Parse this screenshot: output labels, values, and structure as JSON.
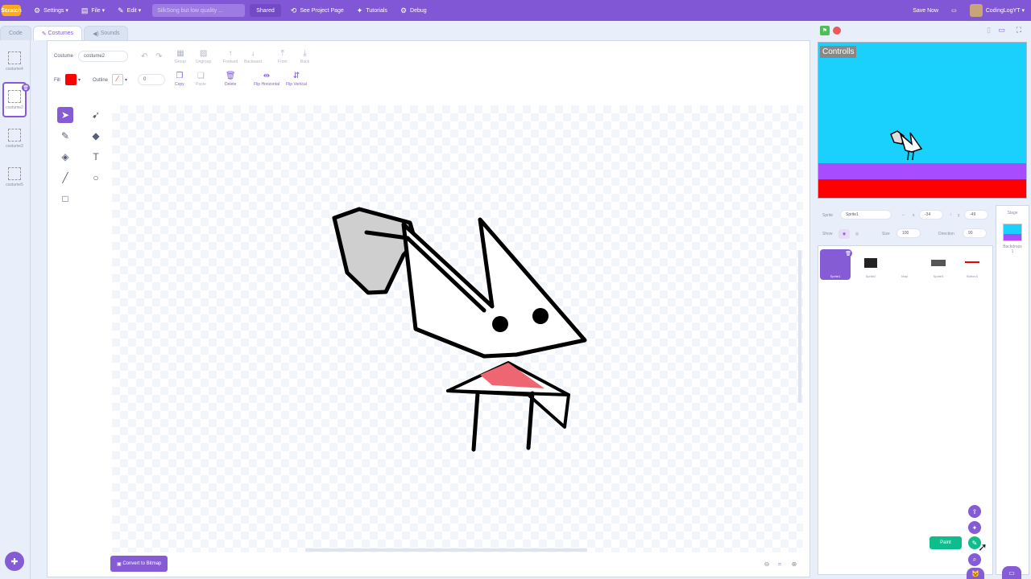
{
  "menubar": {
    "logo": "Scratch",
    "settings": "Settings",
    "file": "File",
    "edit": "Edit",
    "project_title": "SilkSong but low quality ...",
    "shared": "Shared",
    "see_project": "See Project Page",
    "tutorials": "Tutorials",
    "debug": "Debug",
    "save_now": "Save Now",
    "username": "CodingLogYT"
  },
  "tabs": {
    "code": "Code",
    "costumes": "Costumes",
    "sounds": "Sounds"
  },
  "costumes": [
    {
      "name": "costume4"
    },
    {
      "name": "costume2"
    },
    {
      "name": "costume3"
    },
    {
      "name": "costume5"
    }
  ],
  "editor": {
    "costume_label": "Costume",
    "costume_name": "costume2",
    "fill_label": "Fill",
    "outline_label": "Outline",
    "outline_size": "0",
    "fill_color": "#ff0000",
    "group": "Group",
    "ungroup": "Ungroup",
    "forward": "Forward",
    "backward": "Backward",
    "front": "Front",
    "back": "Back",
    "copy": "Copy",
    "paste": "Paste",
    "delete": "Delete",
    "flip_h": "Flip Horizontal",
    "flip_v": "Flip Vertical",
    "convert_bitmap": "Convert to Bitmap"
  },
  "stage": {
    "controls_text": "Controlls",
    "sky": "#19d1fc",
    "platform": "#a84cff",
    "floor": "#ff0000"
  },
  "sprite_info": {
    "sprite_label": "Sprite",
    "sprite_name": "Sprite1",
    "x_label": "x",
    "x": "-34",
    "y_label": "y",
    "y": "-49",
    "show_label": "Show",
    "size_label": "Size",
    "size": "100",
    "direction_label": "Direction",
    "direction": "90"
  },
  "sprites": [
    {
      "name": "Sprite1"
    },
    {
      "name": "Sprite2"
    },
    {
      "name": "Map"
    },
    {
      "name": "Sprite3"
    },
    {
      "name": "Button3"
    }
  ],
  "stage_pane": {
    "title": "Stage",
    "backdrops_label": "Backdrops",
    "backdrops_count": "1"
  },
  "paint_tooltip": "Paint"
}
